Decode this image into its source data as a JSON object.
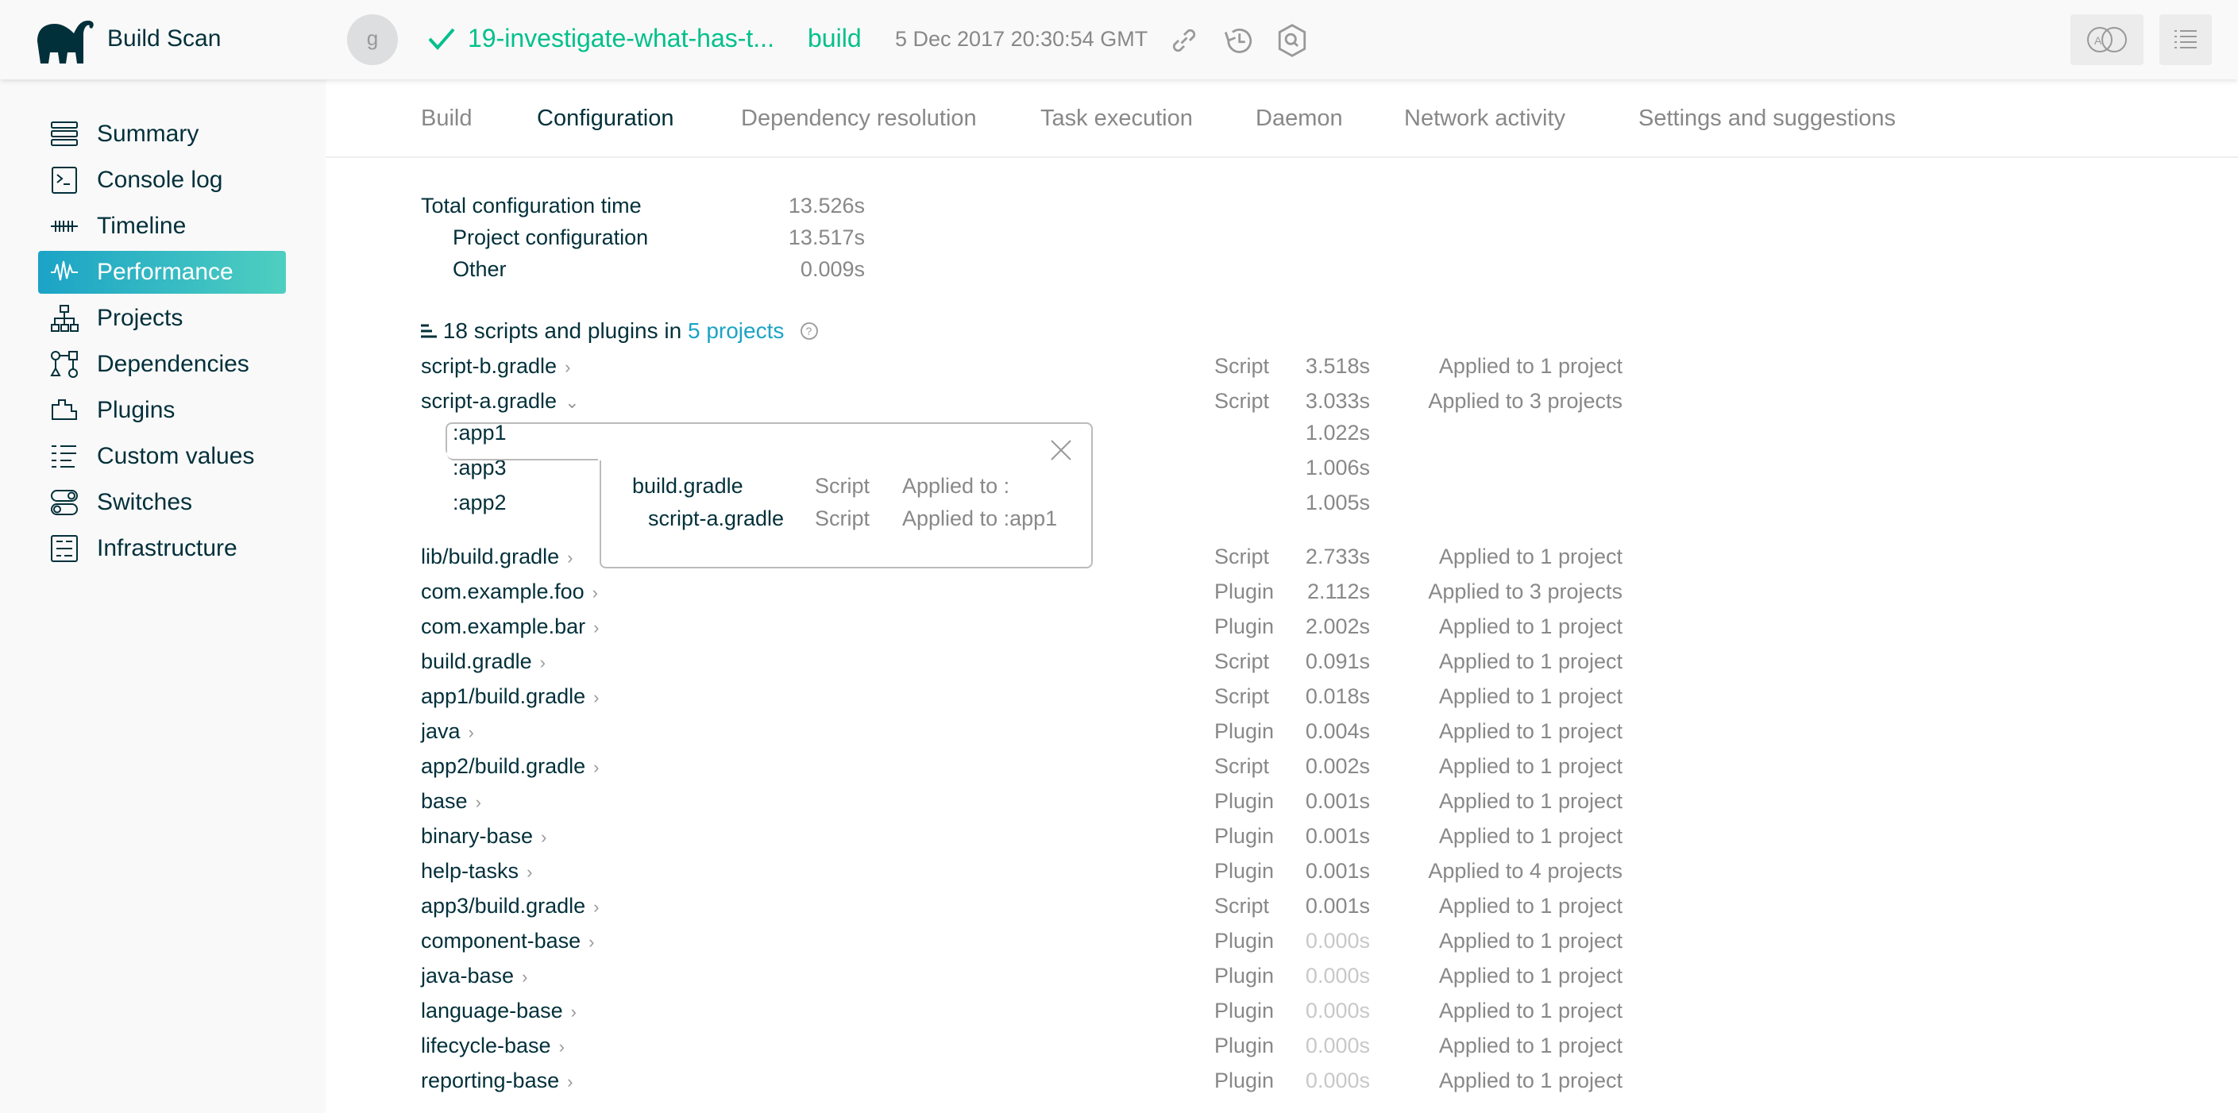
{
  "header": {
    "app_title": "Build Scan",
    "avatar_letter": "g",
    "build_title": "19-investigate-what-has-t...",
    "task": "build",
    "date": "5 Dec 2017 20:30:54 GMT",
    "status_color": "#00c08b"
  },
  "sidebar": {
    "items": [
      {
        "label": "Summary",
        "icon": "summary-icon"
      },
      {
        "label": "Console log",
        "icon": "console-icon"
      },
      {
        "label": "Timeline",
        "icon": "timeline-icon"
      },
      {
        "label": "Performance",
        "icon": "performance-icon",
        "active": true
      },
      {
        "label": "Projects",
        "icon": "projects-icon"
      },
      {
        "label": "Dependencies",
        "icon": "dependencies-icon"
      },
      {
        "label": "Plugins",
        "icon": "plugins-icon"
      },
      {
        "label": "Custom values",
        "icon": "custom-values-icon"
      },
      {
        "label": "Switches",
        "icon": "switches-icon"
      },
      {
        "label": "Infrastructure",
        "icon": "infrastructure-icon"
      }
    ]
  },
  "tabs": [
    "Build",
    "Configuration",
    "Dependency resolution",
    "Task execution",
    "Daemon",
    "Network activity",
    "Settings and suggestions"
  ],
  "summary": {
    "total_label": "Total configuration time",
    "total": "13.526s",
    "project_label": "Project configuration",
    "project": "13.517s",
    "other_label": "Other",
    "other": "0.009s"
  },
  "list": {
    "heading": "18 scripts and plugins",
    "in": "in",
    "projects_link": "5 projects"
  },
  "rows": [
    {
      "name": "script-b.gradle",
      "type": "Script",
      "time": "3.518s",
      "applied": "Applied to 1 project"
    },
    {
      "name": "script-a.gradle",
      "type": "Script",
      "time": "3.033s",
      "applied": "Applied to 3 projects",
      "expanded": true,
      "children": [
        {
          "name": ":app1",
          "time": "1.022s"
        },
        {
          "name": ":app3",
          "time": "1.006s"
        },
        {
          "name": ":app2",
          "time": "1.005s"
        }
      ]
    },
    {
      "name": "lib/build.gradle",
      "type": "Script",
      "time": "2.733s",
      "applied": "Applied to 1 project"
    },
    {
      "name": "com.example.foo",
      "type": "Plugin",
      "time": "2.112s",
      "applied": "Applied to 3 projects"
    },
    {
      "name": "com.example.bar",
      "type": "Plugin",
      "time": "2.002s",
      "applied": "Applied to 1 project"
    },
    {
      "name": "build.gradle",
      "type": "Script",
      "time": "0.091s",
      "applied": "Applied to 1 project"
    },
    {
      "name": "app1/build.gradle",
      "type": "Script",
      "time": "0.018s",
      "applied": "Applied to 1 project"
    },
    {
      "name": "java",
      "type": "Plugin",
      "time": "0.004s",
      "applied": "Applied to 1 project"
    },
    {
      "name": "app2/build.gradle",
      "type": "Script",
      "time": "0.002s",
      "applied": "Applied to 1 project"
    },
    {
      "name": "base",
      "type": "Plugin",
      "time": "0.001s",
      "applied": "Applied to 1 project"
    },
    {
      "name": "binary-base",
      "type": "Plugin",
      "time": "0.001s",
      "applied": "Applied to 1 project"
    },
    {
      "name": "help-tasks",
      "type": "Plugin",
      "time": "0.001s",
      "applied": "Applied to 4 projects"
    },
    {
      "name": "app3/build.gradle",
      "type": "Script",
      "time": "0.001s",
      "applied": "Applied to 1 project"
    },
    {
      "name": "component-base",
      "type": "Plugin",
      "time": "0.000s",
      "applied": "Applied to 1 project"
    },
    {
      "name": "java-base",
      "type": "Plugin",
      "time": "0.000s",
      "applied": "Applied to 1 project"
    },
    {
      "name": "language-base",
      "type": "Plugin",
      "time": "0.000s",
      "applied": "Applied to 1 project"
    },
    {
      "name": "lifecycle-base",
      "type": "Plugin",
      "time": "0.000s",
      "applied": "Applied to 1 project"
    },
    {
      "name": "reporting-base",
      "type": "Plugin",
      "time": "0.000s",
      "applied": "Applied to 1 project"
    }
  ],
  "popup": {
    "rows": [
      {
        "name": "build.gradle",
        "type": "Script",
        "applied": "Applied to :"
      },
      {
        "name": "script-a.gradle",
        "type": "Script",
        "applied": "Applied to :app1"
      }
    ]
  }
}
